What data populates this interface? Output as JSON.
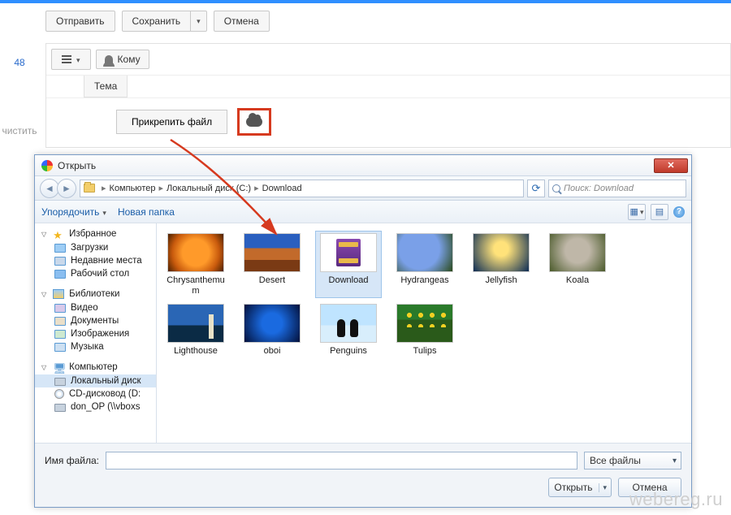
{
  "compose": {
    "send": "Отправить",
    "save": "Сохранить",
    "cancel": "Отмена",
    "to": "Кому",
    "subject": "Тема",
    "attach": "Прикрепить файл",
    "unread": "48",
    "clear": "чистить"
  },
  "dialog": {
    "title": "Открыть",
    "breadcrumbs": [
      "Компьютер",
      "Локальный диск (C:)",
      "Download"
    ],
    "search_placeholder": "Поиск: Download",
    "organize": "Упорядочить",
    "new_folder": "Новая папка",
    "tree": {
      "favorites": "Избранное",
      "fav_items": [
        "Загрузки",
        "Недавние места",
        "Рабочий стол"
      ],
      "libraries": "Библиотеки",
      "lib_items": [
        "Видео",
        "Документы",
        "Изображения",
        "Музыка"
      ],
      "computer": "Компьютер",
      "comp_items": [
        "Локальный диск",
        "CD-дисковод (D:",
        "don_OP (\\\\vboxs"
      ]
    },
    "files": [
      {
        "name": "Chrysanthemum",
        "thumb": "th-chrys"
      },
      {
        "name": "Desert",
        "thumb": "th-desert"
      },
      {
        "name": "Download",
        "thumb": "th-rar"
      },
      {
        "name": "Hydrangeas",
        "thumb": "th-hyd"
      },
      {
        "name": "Jellyfish",
        "thumb": "th-jelly"
      },
      {
        "name": "Koala",
        "thumb": "th-koala"
      },
      {
        "name": "Lighthouse",
        "thumb": "th-light"
      },
      {
        "name": "oboi",
        "thumb": "th-oboi"
      },
      {
        "name": "Penguins",
        "thumb": "th-peng"
      },
      {
        "name": "Tulips",
        "thumb": "th-tulip"
      }
    ],
    "selected_index": 2,
    "filename_label": "Имя файла:",
    "filter": "Все файлы",
    "open": "Открыть",
    "cancel": "Отмена"
  },
  "watermark": "webereg.ru"
}
